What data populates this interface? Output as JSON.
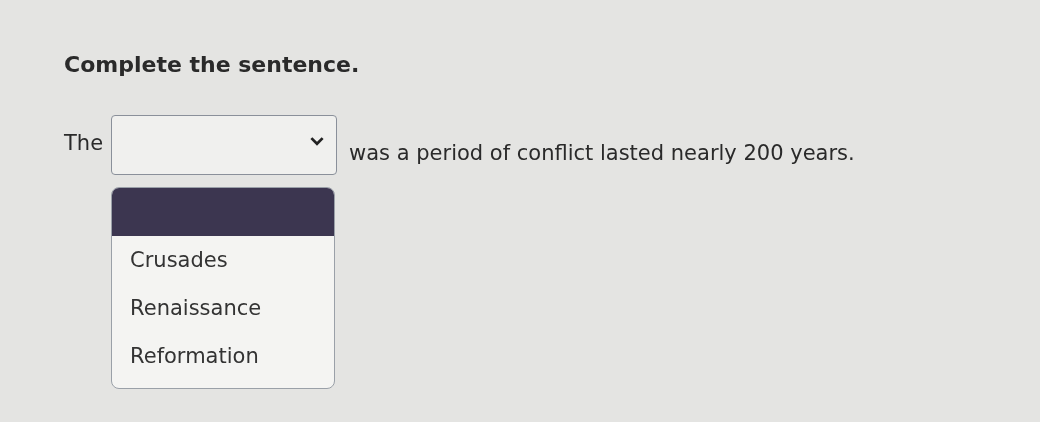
{
  "instruction": "Complete the sentence.",
  "sentence": {
    "before": "The",
    "after": "was a period of conflict lasted nearly 200 years."
  },
  "dropdown": {
    "expanded": true,
    "blank_option_highlighted": true,
    "options": [
      {
        "label": "Crusades",
        "selected": false
      },
      {
        "label": "Renaissance",
        "selected": false
      },
      {
        "label": "Reformation",
        "selected": false
      }
    ]
  }
}
